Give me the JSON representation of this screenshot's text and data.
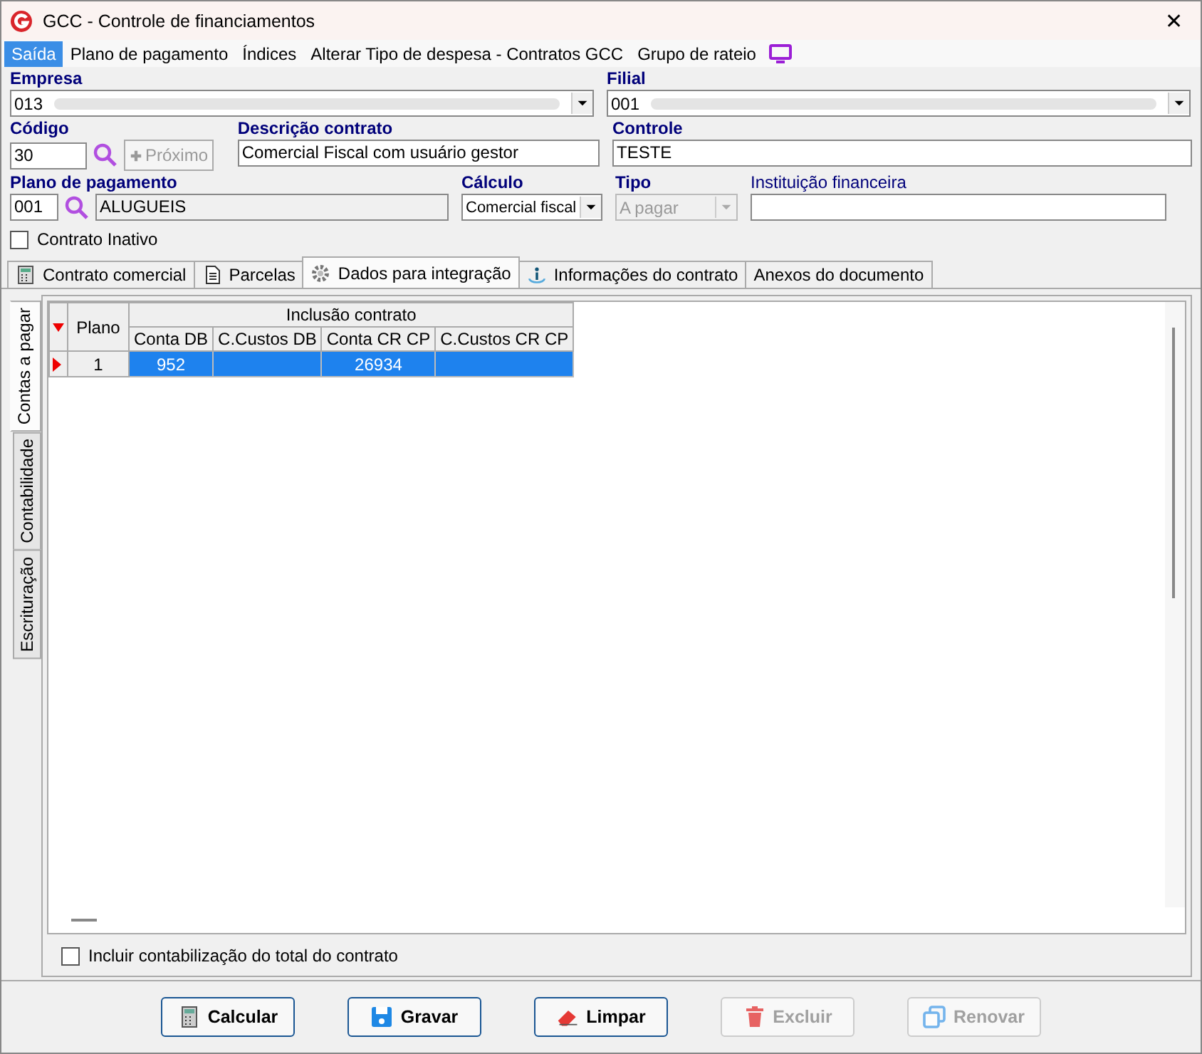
{
  "window": {
    "title": "GCC - Controle de financiamentos",
    "close": "✕"
  },
  "menu": [
    {
      "label": "Saída",
      "selected": true
    },
    {
      "label": "Plano de pagamento",
      "selected": false
    },
    {
      "label": "Índices",
      "selected": false
    },
    {
      "label": "Alterar Tipo de despesa - Contratos GCC",
      "selected": false
    },
    {
      "label": "Grupo de rateio",
      "selected": false
    }
  ],
  "empresa": {
    "label": "Empresa",
    "value": "013"
  },
  "filial": {
    "label": "Filial",
    "value": "001"
  },
  "codigo": {
    "label": "Código",
    "value": "30",
    "next_button": {
      "label": "Próximo",
      "disabled": true
    }
  },
  "descricao": {
    "label": "Descrição contrato",
    "value": "Comercial Fiscal com usuário gestor"
  },
  "controle": {
    "label": "Controle",
    "value": "TESTE"
  },
  "plano": {
    "label": "Plano de pagamento",
    "code": "001",
    "name": "ALUGUEIS"
  },
  "calculo": {
    "label": "Cálculo",
    "value": "Comercial fiscal"
  },
  "tipo": {
    "label": "Tipo",
    "value": "A pagar",
    "disabled": true
  },
  "instituicao": {
    "label": "Instituição financeira"
  },
  "inativo": {
    "label": "Contrato Inativo",
    "checked": false
  },
  "tabs": [
    {
      "label": "Contrato comercial",
      "selected": false
    },
    {
      "label": "Parcelas",
      "selected": false
    },
    {
      "label": "Dados para integração",
      "selected": true
    },
    {
      "label": "Informações do contrato",
      "selected": false
    },
    {
      "label": "Anexos do documento",
      "selected": false
    }
  ],
  "side_tabs": [
    {
      "label": "Contas a pagar",
      "selected": true
    },
    {
      "label": "Contabilidade",
      "selected": false
    },
    {
      "label": "Escrituração",
      "selected": false
    }
  ],
  "table": {
    "group": "Inclusão contrato",
    "first": "Plano",
    "columns": [
      "Conta DB",
      "C.Custos DB",
      "Conta CR CP",
      "C.Custos CR CP"
    ],
    "rows": [
      {
        "plano": "1",
        "cells": [
          "952",
          "",
          "26934",
          ""
        ],
        "selected": true
      }
    ]
  },
  "incluir": {
    "label": "Incluir contabilização do total do contrato",
    "checked": false
  },
  "buttons": [
    {
      "label": "Calcular",
      "disabled": false
    },
    {
      "label": "Gravar",
      "disabled": false
    },
    {
      "label": "Limpar",
      "disabled": false
    },
    {
      "label": "Excluir",
      "disabled": true
    },
    {
      "label": "Renovar",
      "disabled": true
    }
  ]
}
